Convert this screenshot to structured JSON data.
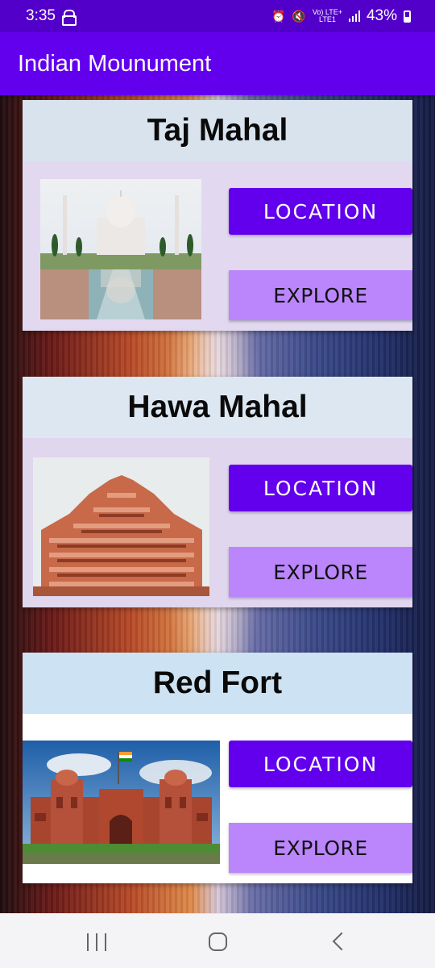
{
  "status_bar": {
    "time": "3:35",
    "network_top": "Vo) LTE+",
    "network_bottom": "LTE1",
    "battery": "43%"
  },
  "app": {
    "title": "Indian Mounument"
  },
  "cards": [
    {
      "title": "Taj Mahal",
      "location_label": "LOCATION",
      "explore_label": "EXPLORE",
      "image_icon": "taj-mahal-photo"
    },
    {
      "title": "Hawa Mahal",
      "location_label": "LOCATION",
      "explore_label": "EXPLORE",
      "image_icon": "hawa-mahal-photo"
    },
    {
      "title": "Red Fort",
      "location_label": "LOCATION",
      "explore_label": "EXPLORE",
      "image_icon": "red-fort-photo"
    }
  ],
  "colors": {
    "primary": "#6200ee",
    "primary_dark": "#5200c9",
    "accent": "#bb86fc"
  },
  "nav_bar": {
    "icons": [
      "recent-apps-icon",
      "home-icon",
      "back-icon"
    ]
  }
}
